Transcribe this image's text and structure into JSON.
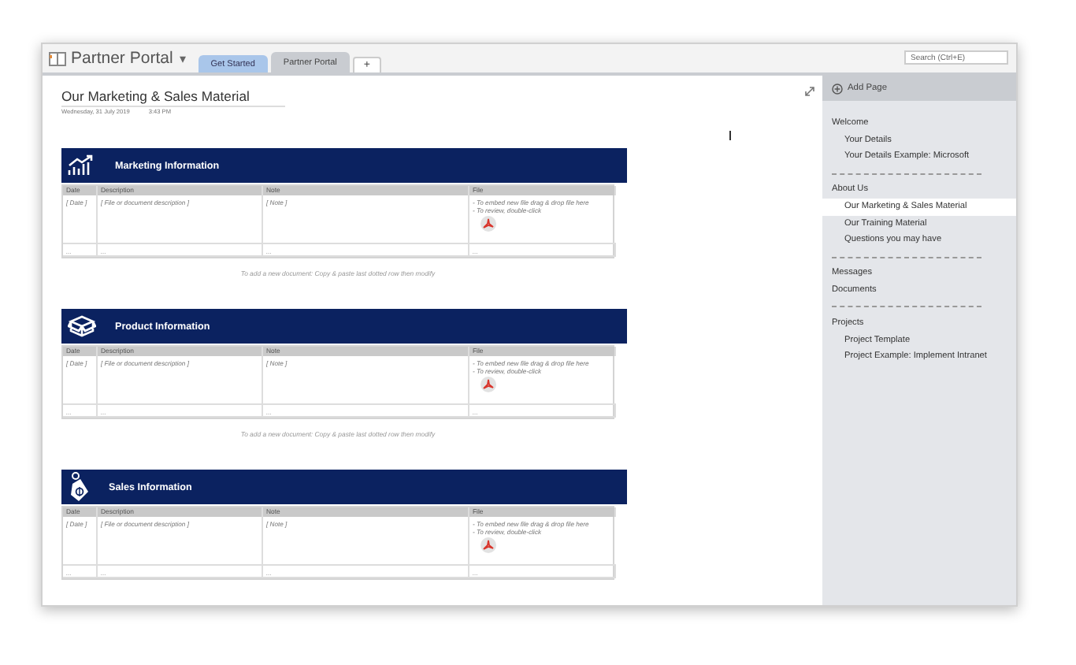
{
  "notebook": {
    "title": "Partner Portal",
    "caret": "▾",
    "tabs": [
      {
        "label": "Get Started",
        "selected": false,
        "color": "#a9c6ea"
      },
      {
        "label": "Partner Portal",
        "selected": true,
        "color": "#c9ccd1"
      }
    ],
    "add_tab": "+"
  },
  "search": {
    "placeholder": "Search (Ctrl+E)"
  },
  "page": {
    "title": "Our Marketing & Sales Material",
    "date": "Wednesday, 31 July 2019",
    "time": "3:43 PM",
    "sections": [
      {
        "heading": "Marketing Information",
        "columns": [
          "Date",
          "Description",
          "Note",
          "File"
        ],
        "entry": [
          "[ Date ]",
          "[ File or document description ]",
          "[ Note ]"
        ],
        "file_notes": [
          "- To embed new file drag & drop file here",
          "- To review, double-click"
        ],
        "dotted": [
          "...",
          "...",
          "...",
          "..."
        ],
        "hint": "To add a new document: Copy & paste last dotted row then modify"
      },
      {
        "heading": "Product Information",
        "columns": [
          "Date",
          "Description",
          "Note",
          "File"
        ],
        "entry": [
          "[ Date ]",
          "[ File or document description ]",
          "[ Note ]"
        ],
        "file_notes": [
          "- To embed new file drag & drop file here",
          "- To review, double-click"
        ],
        "dotted": [
          "...",
          "...",
          "...",
          "..."
        ],
        "hint": "To add a new document: Copy & paste last dotted row then modify"
      },
      {
        "heading": "Sales Information",
        "columns": [
          "Date",
          "Description",
          "Note",
          "File"
        ],
        "entry": [
          "[ Date ]",
          "[ File or document description ]",
          "[ Note ]"
        ],
        "file_notes": [
          "- To embed new file drag & drop file here",
          "- To review, double-click"
        ],
        "dotted": [
          "...",
          "...",
          "...",
          "..."
        ]
      }
    ]
  },
  "sidebar": {
    "add_page": "Add Page",
    "pages": [
      {
        "kind": "page",
        "label": "Welcome",
        "selected": false,
        "children": [
          {
            "kind": "page",
            "label": "Your Details",
            "selected": false
          },
          {
            "kind": "page",
            "label": "Your Details Example: Microsoft",
            "selected": false
          }
        ]
      },
      {
        "kind": "separator"
      },
      {
        "kind": "page",
        "label": "About Us",
        "selected": false,
        "children": [
          {
            "kind": "page",
            "label": "Our Marketing & Sales Material",
            "selected": true
          },
          {
            "kind": "page",
            "label": "Our Training Material",
            "selected": false
          },
          {
            "kind": "page",
            "label": "Questions you may have",
            "selected": false
          }
        ]
      },
      {
        "kind": "separator"
      },
      {
        "kind": "page",
        "label": "Messages",
        "selected": false
      },
      {
        "kind": "page",
        "label": "Documents",
        "selected": false
      },
      {
        "kind": "separator"
      },
      {
        "kind": "page",
        "label": "Projects",
        "selected": false,
        "children": [
          {
            "kind": "page",
            "label": "Project Template",
            "selected": false
          },
          {
            "kind": "page",
            "label": "Project Example: Implement Intranet",
            "selected": false
          }
        ]
      }
    ]
  }
}
